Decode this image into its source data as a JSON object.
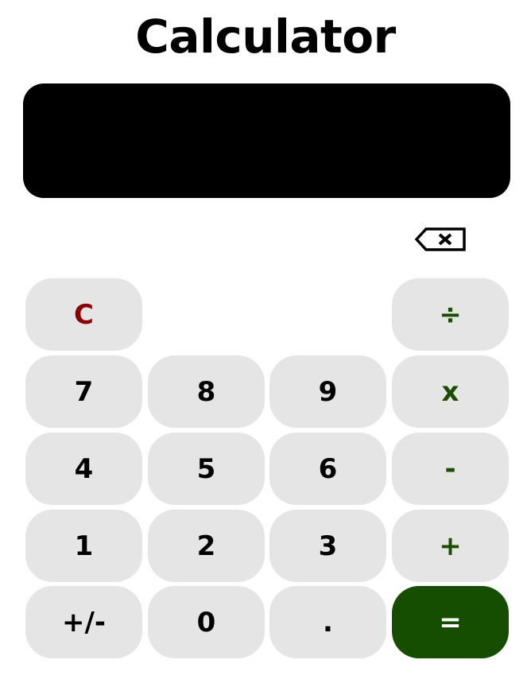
{
  "app": {
    "title": "Calculator"
  },
  "display": {
    "value": ""
  },
  "backspace": {
    "icon": "backspace-icon"
  },
  "keys": {
    "clear": "C",
    "divide": "÷",
    "seven": "7",
    "eight": "8",
    "nine": "9",
    "multiply": "x",
    "four": "4",
    "five": "5",
    "six": "6",
    "subtract": "-",
    "one": "1",
    "two": "2",
    "three": "3",
    "add": "+",
    "negate": "+/-",
    "zero": "0",
    "decimal": ".",
    "equals": "="
  },
  "colors": {
    "key_background": "#e5e5e5",
    "clear_text": "#8b0000",
    "operator_text": "#1a4d00",
    "equals_background": "#164e00",
    "display_background": "#000000"
  }
}
